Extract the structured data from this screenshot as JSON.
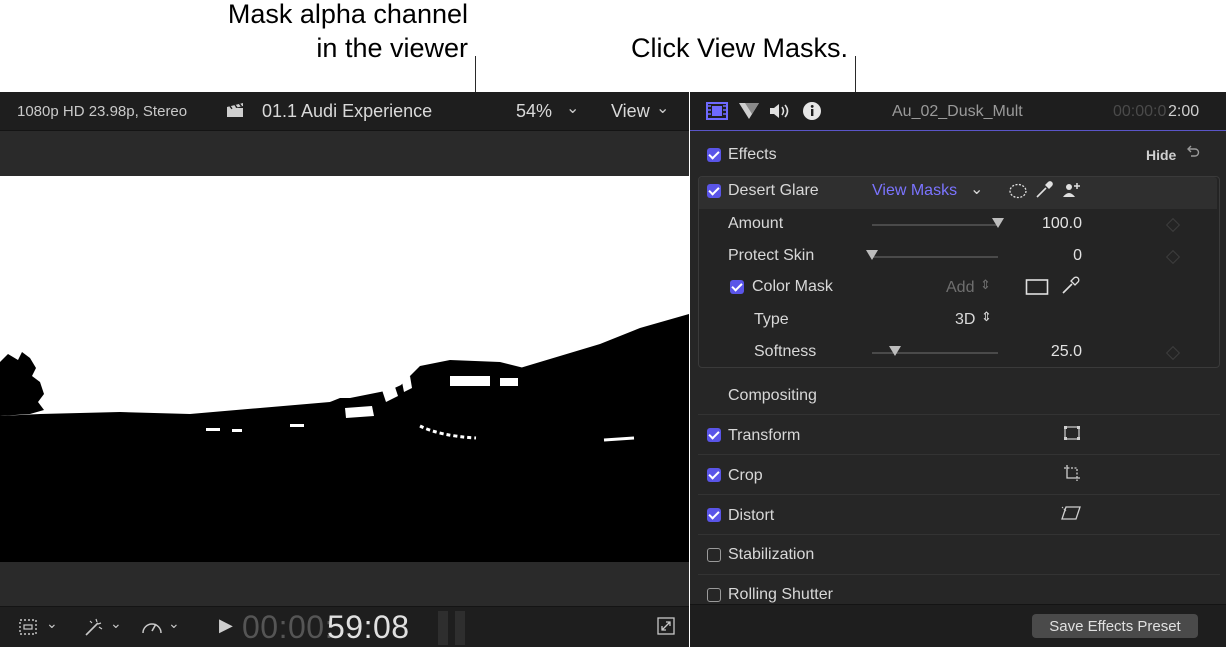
{
  "callouts": {
    "mask_line1": "Mask alpha channel",
    "mask_line2": "in the viewer",
    "view_masks": "Click View Masks."
  },
  "viewer": {
    "format": "1080p HD 23.98p, Stereo",
    "project": "01.1 Audi Experience",
    "zoom": "54%",
    "view_menu": "View",
    "timecode_dim": "00:00:",
    "timecode": "59:08"
  },
  "inspector": {
    "clip_name": "Au_02_Dusk_Mult",
    "timecode_dim": "00:00:0",
    "timecode": "2:00",
    "effects_label": "Effects",
    "hide_label": "Hide",
    "effect": {
      "name": "Desert Glare",
      "view_masks": "View Masks",
      "params": [
        {
          "label": "Amount",
          "value": "100.0",
          "level": 1.0
        },
        {
          "label": "Protect Skin",
          "value": "0",
          "level": 0.0
        }
      ],
      "color_mask": {
        "label": "Color Mask",
        "add_label": "Add",
        "type_label": "Type",
        "type_value": "3D",
        "softness_label": "Softness",
        "softness_value": "25.0",
        "softness_level": 0.18
      }
    },
    "sections": [
      {
        "label": "Compositing",
        "checked": null
      },
      {
        "label": "Transform",
        "checked": true
      },
      {
        "label": "Crop",
        "checked": true
      },
      {
        "label": "Distort",
        "checked": true
      },
      {
        "label": "Stabilization",
        "checked": false
      },
      {
        "label": "Rolling Shutter",
        "checked": false
      }
    ],
    "save_preset": "Save Effects Preset"
  },
  "colors": {
    "accent": "#5a55e8",
    "link": "#7b74ff",
    "panel": "#262626"
  }
}
